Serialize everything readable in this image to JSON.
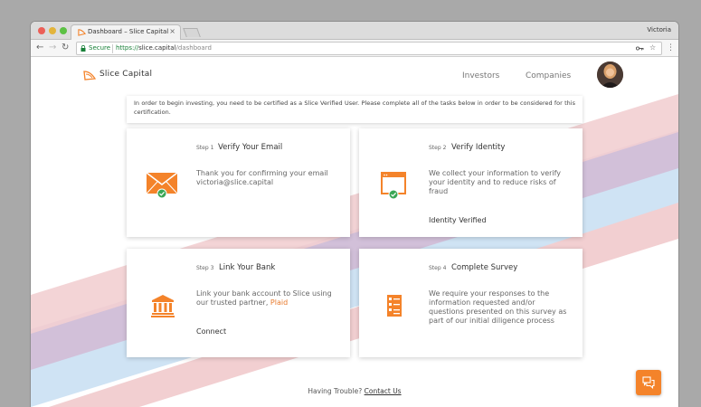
{
  "browser": {
    "tab_title": "Dashboard – Slice Capital",
    "tab_close": "×",
    "profile_name": "Victoria",
    "secure_label": "Secure",
    "url_scheme": "https://",
    "url_host": "slice.capital",
    "url_path": "/dashboard"
  },
  "header": {
    "brand_name": "Slice Capital",
    "nav": [
      {
        "label": "Investors"
      },
      {
        "label": "Companies"
      }
    ]
  },
  "notice": "In order to begin investing, you need to be certified as a Slice Verified User. Please complete all of the tasks below in order to be considered for this certification.",
  "steps": [
    {
      "step": "Step 1",
      "title": "Verify Your Email",
      "text": "Thank you for confirming your email victoria@slice.capital",
      "icon": "envelope-check-icon"
    },
    {
      "step": "Step 2",
      "title": "Verify Identity",
      "text": "We collect your information to verify your identity and to reduce risks of fraud",
      "status": "Identity Verified",
      "icon": "id-window-check-icon"
    },
    {
      "step": "Step 3",
      "title": "Link Your Bank",
      "text_before": "Link your bank account to Slice using our trusted partner,",
      "partner": "Plaid",
      "action": "Connect",
      "icon": "bank-icon"
    },
    {
      "step": "Step 4",
      "title": "Complete Survey",
      "text": "We require your responses to the information requested and/or questions presented on this survey as part of our initial diligence process",
      "icon": "survey-icon"
    }
  ],
  "footer": {
    "trouble_text": "Having Trouble?",
    "contact_label": "Contact Us"
  },
  "colors": {
    "accent": "#f4832a",
    "success": "#3aa655",
    "stripe_blue": "#cfe3f4",
    "stripe_purple": "#d2c0d9",
    "stripe_pink": "#f2cfd1"
  }
}
